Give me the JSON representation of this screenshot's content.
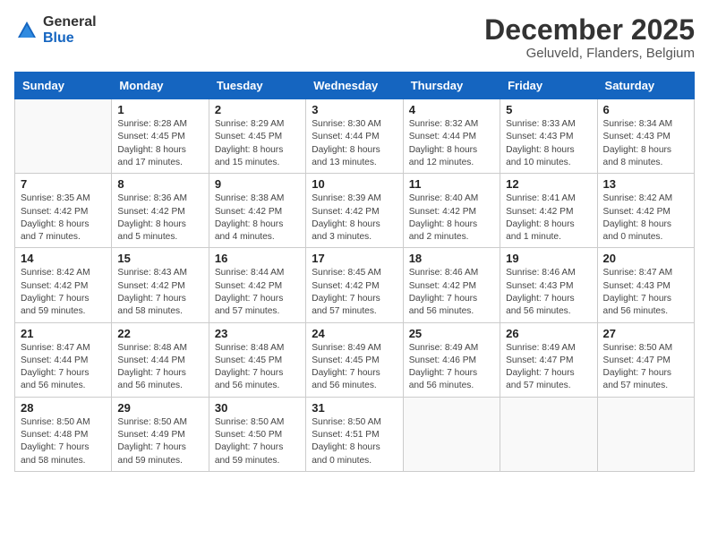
{
  "logo": {
    "text_general": "General",
    "text_blue": "Blue"
  },
  "header": {
    "month": "December 2025",
    "location": "Geluveld, Flanders, Belgium"
  },
  "days_of_week": [
    "Sunday",
    "Monday",
    "Tuesday",
    "Wednesday",
    "Thursday",
    "Friday",
    "Saturday"
  ],
  "weeks": [
    [
      {
        "day": "",
        "info": ""
      },
      {
        "day": "1",
        "info": "Sunrise: 8:28 AM\nSunset: 4:45 PM\nDaylight: 8 hours\nand 17 minutes."
      },
      {
        "day": "2",
        "info": "Sunrise: 8:29 AM\nSunset: 4:45 PM\nDaylight: 8 hours\nand 15 minutes."
      },
      {
        "day": "3",
        "info": "Sunrise: 8:30 AM\nSunset: 4:44 PM\nDaylight: 8 hours\nand 13 minutes."
      },
      {
        "day": "4",
        "info": "Sunrise: 8:32 AM\nSunset: 4:44 PM\nDaylight: 8 hours\nand 12 minutes."
      },
      {
        "day": "5",
        "info": "Sunrise: 8:33 AM\nSunset: 4:43 PM\nDaylight: 8 hours\nand 10 minutes."
      },
      {
        "day": "6",
        "info": "Sunrise: 8:34 AM\nSunset: 4:43 PM\nDaylight: 8 hours\nand 8 minutes."
      }
    ],
    [
      {
        "day": "7",
        "info": "Sunrise: 8:35 AM\nSunset: 4:42 PM\nDaylight: 8 hours\nand 7 minutes."
      },
      {
        "day": "8",
        "info": "Sunrise: 8:36 AM\nSunset: 4:42 PM\nDaylight: 8 hours\nand 5 minutes."
      },
      {
        "day": "9",
        "info": "Sunrise: 8:38 AM\nSunset: 4:42 PM\nDaylight: 8 hours\nand 4 minutes."
      },
      {
        "day": "10",
        "info": "Sunrise: 8:39 AM\nSunset: 4:42 PM\nDaylight: 8 hours\nand 3 minutes."
      },
      {
        "day": "11",
        "info": "Sunrise: 8:40 AM\nSunset: 4:42 PM\nDaylight: 8 hours\nand 2 minutes."
      },
      {
        "day": "12",
        "info": "Sunrise: 8:41 AM\nSunset: 4:42 PM\nDaylight: 8 hours\nand 1 minute."
      },
      {
        "day": "13",
        "info": "Sunrise: 8:42 AM\nSunset: 4:42 PM\nDaylight: 8 hours\nand 0 minutes."
      }
    ],
    [
      {
        "day": "14",
        "info": "Sunrise: 8:42 AM\nSunset: 4:42 PM\nDaylight: 7 hours\nand 59 minutes."
      },
      {
        "day": "15",
        "info": "Sunrise: 8:43 AM\nSunset: 4:42 PM\nDaylight: 7 hours\nand 58 minutes."
      },
      {
        "day": "16",
        "info": "Sunrise: 8:44 AM\nSunset: 4:42 PM\nDaylight: 7 hours\nand 57 minutes."
      },
      {
        "day": "17",
        "info": "Sunrise: 8:45 AM\nSunset: 4:42 PM\nDaylight: 7 hours\nand 57 minutes."
      },
      {
        "day": "18",
        "info": "Sunrise: 8:46 AM\nSunset: 4:42 PM\nDaylight: 7 hours\nand 56 minutes."
      },
      {
        "day": "19",
        "info": "Sunrise: 8:46 AM\nSunset: 4:43 PM\nDaylight: 7 hours\nand 56 minutes."
      },
      {
        "day": "20",
        "info": "Sunrise: 8:47 AM\nSunset: 4:43 PM\nDaylight: 7 hours\nand 56 minutes."
      }
    ],
    [
      {
        "day": "21",
        "info": "Sunrise: 8:47 AM\nSunset: 4:44 PM\nDaylight: 7 hours\nand 56 minutes."
      },
      {
        "day": "22",
        "info": "Sunrise: 8:48 AM\nSunset: 4:44 PM\nDaylight: 7 hours\nand 56 minutes."
      },
      {
        "day": "23",
        "info": "Sunrise: 8:48 AM\nSunset: 4:45 PM\nDaylight: 7 hours\nand 56 minutes."
      },
      {
        "day": "24",
        "info": "Sunrise: 8:49 AM\nSunset: 4:45 PM\nDaylight: 7 hours\nand 56 minutes."
      },
      {
        "day": "25",
        "info": "Sunrise: 8:49 AM\nSunset: 4:46 PM\nDaylight: 7 hours\nand 56 minutes."
      },
      {
        "day": "26",
        "info": "Sunrise: 8:49 AM\nSunset: 4:47 PM\nDaylight: 7 hours\nand 57 minutes."
      },
      {
        "day": "27",
        "info": "Sunrise: 8:50 AM\nSunset: 4:47 PM\nDaylight: 7 hours\nand 57 minutes."
      }
    ],
    [
      {
        "day": "28",
        "info": "Sunrise: 8:50 AM\nSunset: 4:48 PM\nDaylight: 7 hours\nand 58 minutes."
      },
      {
        "day": "29",
        "info": "Sunrise: 8:50 AM\nSunset: 4:49 PM\nDaylight: 7 hours\nand 59 minutes."
      },
      {
        "day": "30",
        "info": "Sunrise: 8:50 AM\nSunset: 4:50 PM\nDaylight: 7 hours\nand 59 minutes."
      },
      {
        "day": "31",
        "info": "Sunrise: 8:50 AM\nSunset: 4:51 PM\nDaylight: 8 hours\nand 0 minutes."
      },
      {
        "day": "",
        "info": ""
      },
      {
        "day": "",
        "info": ""
      },
      {
        "day": "",
        "info": ""
      }
    ]
  ]
}
